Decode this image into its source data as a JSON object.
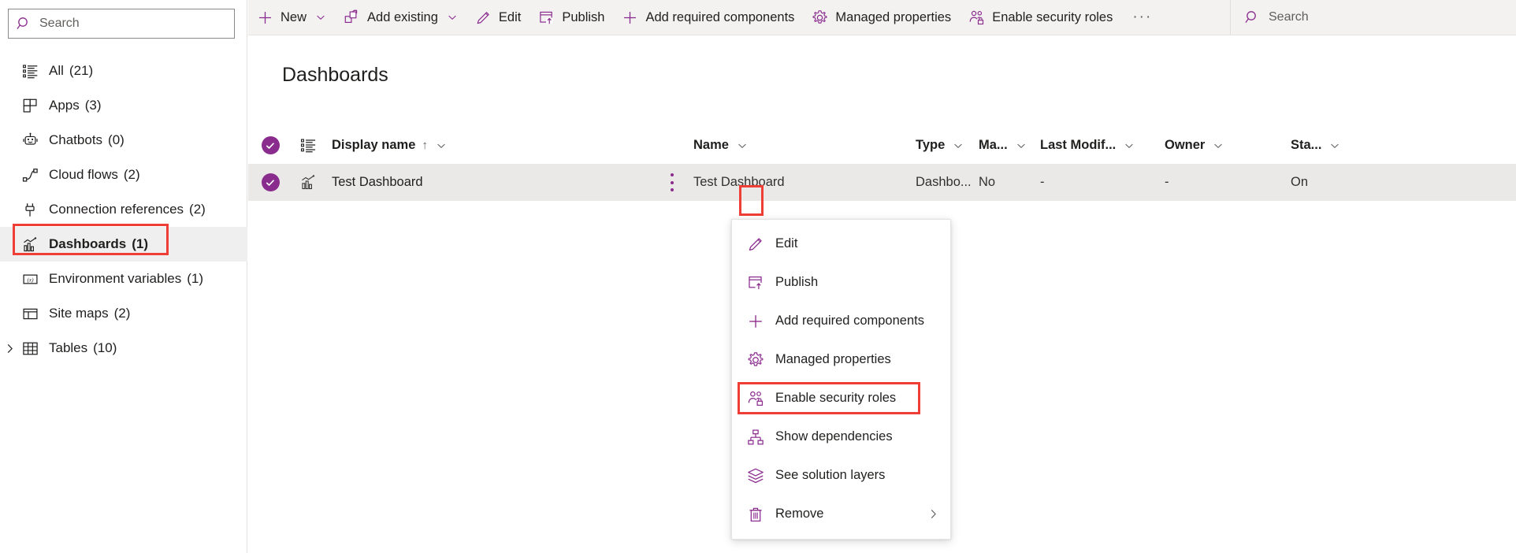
{
  "theme": {
    "accent": "#8a2b8e",
    "highlight_red": "#ef3e36",
    "row_selected_bg": "#ebe9e7",
    "commandbar_bg": "#f3f2f1",
    "sidebar_selected_bg": "#efefef"
  },
  "sidebar": {
    "search": {
      "placeholder": "Search",
      "value": "",
      "icon": "search-icon"
    },
    "items": [
      {
        "icon": "all-list-icon",
        "label": "All",
        "count": "(21)",
        "selected": false,
        "expandable": false
      },
      {
        "icon": "apps-icon",
        "label": "Apps",
        "count": "(3)",
        "selected": false,
        "expandable": false
      },
      {
        "icon": "chatbot-icon",
        "label": "Chatbots",
        "count": "(0)",
        "selected": false,
        "expandable": false
      },
      {
        "icon": "cloud-flow-icon",
        "label": "Cloud flows",
        "count": "(2)",
        "selected": false,
        "expandable": false
      },
      {
        "icon": "connection-reference-icon",
        "label": "Connection references",
        "count": "(2)",
        "selected": false,
        "expandable": false
      },
      {
        "icon": "dashboard-icon",
        "label": "Dashboards",
        "count": "(1)",
        "selected": true,
        "expandable": false
      },
      {
        "icon": "environment-variable-icon",
        "label": "Environment variables",
        "count": "(1)",
        "selected": false,
        "expandable": false
      },
      {
        "icon": "site-map-icon",
        "label": "Site maps",
        "count": "(2)",
        "selected": false,
        "expandable": false
      },
      {
        "icon": "table-icon",
        "label": "Tables",
        "count": "(10)",
        "selected": false,
        "expandable": true
      }
    ]
  },
  "commandbar": {
    "items": [
      {
        "icon": "plus-icon",
        "label": "New",
        "caret": true
      },
      {
        "icon": "add-existing-icon",
        "label": "Add existing",
        "caret": true
      },
      {
        "icon": "pencil-icon",
        "label": "Edit",
        "caret": false
      },
      {
        "icon": "publish-icon",
        "label": "Publish",
        "caret": false
      },
      {
        "icon": "plus-icon",
        "label": "Add required components",
        "caret": false
      },
      {
        "icon": "gear-icon",
        "label": "Managed properties",
        "caret": false
      },
      {
        "icon": "security-roles-icon",
        "label": "Enable security roles",
        "caret": false
      }
    ],
    "overflow_label": "···",
    "search": {
      "placeholder": "Search",
      "value": "",
      "icon": "search-icon"
    }
  },
  "main": {
    "title": "Dashboards",
    "grid": {
      "select_all": {
        "name": "select-all-checkbox",
        "checked": true
      },
      "columns": [
        {
          "key": "display_name",
          "label": "Display name",
          "sorted": "ascending",
          "sort_glyph": "↑",
          "caret": true
        },
        {
          "key": "name",
          "label": "Name",
          "sorted": "",
          "sort_glyph": "",
          "caret": true
        },
        {
          "key": "type",
          "label": "Type",
          "sorted": "",
          "sort_glyph": "",
          "caret": true
        },
        {
          "key": "managed",
          "label": "Ma...",
          "sorted": "",
          "sort_glyph": "",
          "caret": true
        },
        {
          "key": "last_modified",
          "label": "Last Modif...",
          "sorted": "",
          "sort_glyph": "",
          "caret": true
        },
        {
          "key": "owner",
          "label": "Owner",
          "sorted": "",
          "sort_glyph": "",
          "caret": true
        },
        {
          "key": "status",
          "label": "Sta...",
          "sorted": "",
          "sort_glyph": "",
          "caret": true
        }
      ],
      "rows": [
        {
          "checked": true,
          "row_icon": "dashboard-icon",
          "display_name": "Test Dashboard",
          "name": "Test Dashboard",
          "type": "Dashbo...",
          "managed": "No",
          "last_modified": "-",
          "owner": "-",
          "status": "On",
          "selected": true
        }
      ]
    }
  },
  "context_menu": {
    "items": [
      {
        "icon": "pencil-icon",
        "label": "Edit",
        "submenu": false,
        "highlighted": false
      },
      {
        "icon": "publish-icon",
        "label": "Publish",
        "submenu": false,
        "highlighted": false
      },
      {
        "icon": "plus-icon",
        "label": "Add required components",
        "submenu": false,
        "highlighted": false
      },
      {
        "icon": "gear-icon",
        "label": "Managed properties",
        "submenu": false,
        "highlighted": false
      },
      {
        "icon": "security-roles-icon",
        "label": "Enable security roles",
        "submenu": false,
        "highlighted": true
      },
      {
        "icon": "dependencies-icon",
        "label": "Show dependencies",
        "submenu": false,
        "highlighted": false
      },
      {
        "icon": "solution-layers-icon",
        "label": "See solution layers",
        "submenu": false,
        "highlighted": false
      },
      {
        "icon": "trash-icon",
        "label": "Remove",
        "submenu": true,
        "highlighted": false
      }
    ]
  },
  "annotations": [
    {
      "name": "sidebar-dashboards-highlight",
      "target": "Dashboards"
    },
    {
      "name": "row-more-options-highlight",
      "target": "more options"
    },
    {
      "name": "menu-enable-security-roles-highlight",
      "target": "Enable security roles"
    }
  ]
}
